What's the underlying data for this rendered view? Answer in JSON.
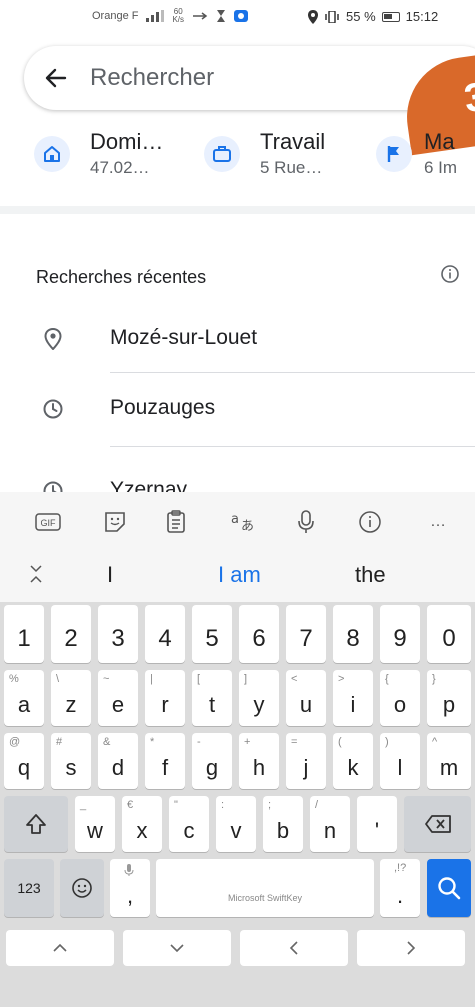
{
  "status_bar": {
    "carrier": "Orange F",
    "net_speed_value": "60",
    "net_speed_unit": "K/s",
    "battery": "55 %",
    "time": "15:12"
  },
  "search": {
    "placeholder": "Rechercher",
    "badge_text": "3"
  },
  "shortcuts": [
    {
      "title": "Domi…",
      "subtitle": "47.02…",
      "icon": "home-icon"
    },
    {
      "title": "Travail",
      "subtitle": "5 Rue…",
      "icon": "briefcase-icon"
    },
    {
      "title": "Ma",
      "subtitle": "6 Im",
      "icon": "flag-icon"
    }
  ],
  "recent": {
    "title": "Recherches récentes",
    "items": [
      {
        "label": "Mozé-sur-Louet",
        "icon": "place-icon"
      },
      {
        "label": "Pouzauges",
        "icon": "history-icon"
      },
      {
        "label": "Yzernay",
        "icon": "history-icon"
      }
    ]
  },
  "keyboard": {
    "toolbar": [
      "GIF",
      "sticker",
      "clipboard",
      "translate",
      "mic",
      "info",
      "…"
    ],
    "suggestions": [
      "I",
      "I am",
      "the"
    ],
    "number_row": [
      "1",
      "2",
      "3",
      "4",
      "5",
      "6",
      "7",
      "8",
      "9",
      "0"
    ],
    "row1": [
      {
        "k": "a",
        "alt": "%"
      },
      {
        "k": "z",
        "alt": "\\"
      },
      {
        "k": "e",
        "alt": "~"
      },
      {
        "k": "r",
        "alt": "|"
      },
      {
        "k": "t",
        "alt": "["
      },
      {
        "k": "y",
        "alt": "]"
      },
      {
        "k": "u",
        "alt": "<"
      },
      {
        "k": "i",
        "alt": ">"
      },
      {
        "k": "o",
        "alt": "{"
      },
      {
        "k": "p",
        "alt": "}"
      }
    ],
    "row2": [
      {
        "k": "q",
        "alt": "@"
      },
      {
        "k": "s",
        "alt": "#"
      },
      {
        "k": "d",
        "alt": "&"
      },
      {
        "k": "f",
        "alt": "*"
      },
      {
        "k": "g",
        "alt": "-"
      },
      {
        "k": "h",
        "alt": "+"
      },
      {
        "k": "j",
        "alt": "="
      },
      {
        "k": "k",
        "alt": "("
      },
      {
        "k": "l",
        "alt": ")"
      },
      {
        "k": "m",
        "alt": "^"
      }
    ],
    "row3": [
      {
        "k": "w",
        "alt": "_"
      },
      {
        "k": "x",
        "alt": "€"
      },
      {
        "k": "c",
        "alt": "\""
      },
      {
        "k": "v",
        "alt": ":"
      },
      {
        "k": "b",
        "alt": ";"
      },
      {
        "k": "n",
        "alt": "/"
      },
      {
        "k": "'",
        "alt": ""
      }
    ],
    "num_label": "123",
    "space_label": "Microsoft SwiftKey",
    "comma": ",",
    "period": "."
  },
  "colors": {
    "accent": "#1a73e8",
    "badge": "#d9692a"
  }
}
